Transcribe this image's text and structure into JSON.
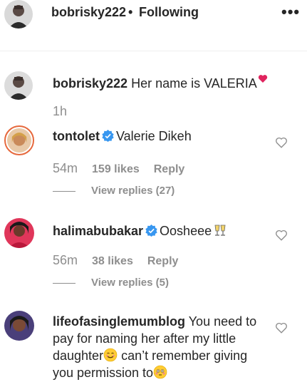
{
  "header": {
    "username": "bobrisky222",
    "separator": "•",
    "follow_status": "Following",
    "more_label": "•••"
  },
  "caption": {
    "username": "bobrisky222",
    "text": "Her name is VALERIA",
    "time": "1h"
  },
  "comments": [
    {
      "username": "tontolet",
      "verified": true,
      "text": "Valerie Dikeh",
      "time": "54m",
      "likes": "159 likes",
      "reply_label": "Reply",
      "view_replies": "View replies (27)"
    },
    {
      "username": "halimabubakar",
      "verified": true,
      "text": "Oosheee",
      "time": "56m",
      "likes": "38 likes",
      "reply_label": "Reply",
      "view_replies": "View replies (5)"
    },
    {
      "username": "lifeofasinglemumblog",
      "verified": false,
      "text_line1": "You need to pay for naming her after my little daughter",
      "text_line2": " can’t remember giving you permission to"
    }
  ],
  "colors": {
    "verified_blue": "#3897f0",
    "muted": "#8e8e8e",
    "text": "#262626"
  }
}
